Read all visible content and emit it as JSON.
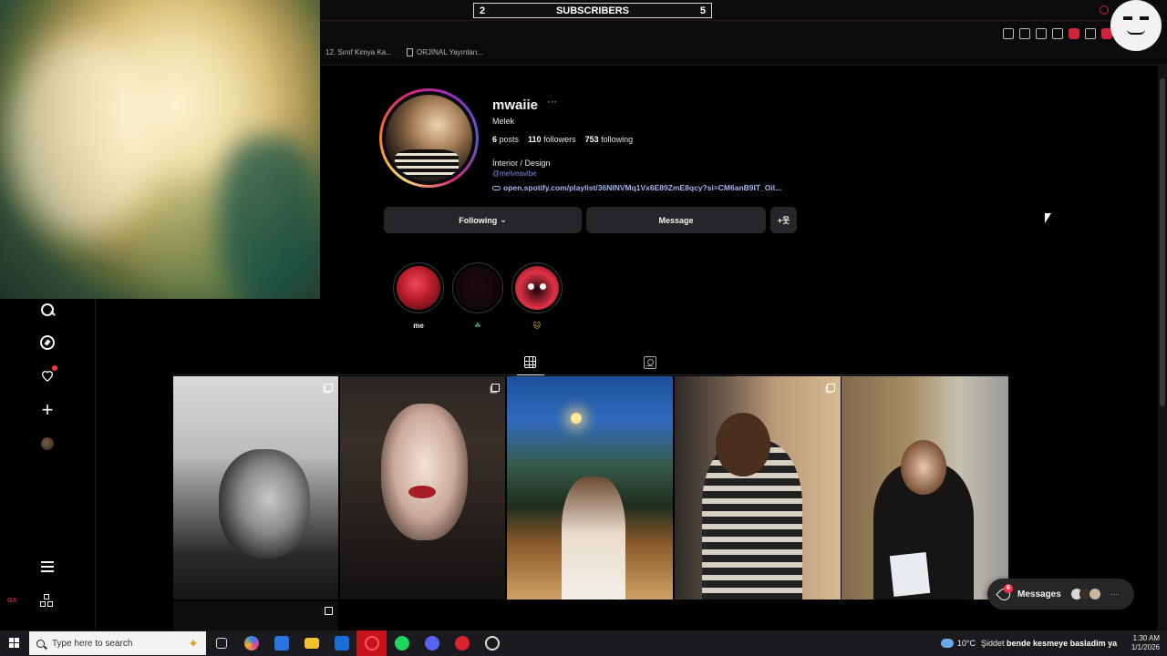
{
  "stream_widget": {
    "left_count": "2",
    "label": "SUBSCRIBERS",
    "right_count": "5"
  },
  "bookmarks": [
    {
      "label": "12. Sınıf Kimya Ka..."
    },
    {
      "label": "ORJİNAL Yayınları..."
    }
  ],
  "profile": {
    "username": "mwaiie",
    "more": "···",
    "full_name": "Melek",
    "stats": {
      "posts_count": "6",
      "posts_label": "posts",
      "followers_count": "110",
      "followers_label": "followers",
      "following_count": "753",
      "following_label": "following"
    },
    "bio": "İnterior / Design",
    "handle": "@melveavibe",
    "link": "open.spotify.com/playlist/36NINVMq1Vx6E89ZmE8qcy?si=CM6anB9IT_Oil...",
    "buttons": {
      "following": "Following",
      "message": "Message",
      "suggest": "+웃"
    }
  },
  "highlights": [
    {
      "label": "me"
    },
    {
      "label": "☘"
    },
    {
      "label": "🐱"
    }
  ],
  "messages": {
    "label": "Messages",
    "badge": "6",
    "more": "···"
  },
  "taskbar": {
    "search_placeholder": "Type here to search",
    "weather": "10°C",
    "ticker_prefix": "Şiddet",
    "ticker_text": "bende kesmeye basladim ya u",
    "time": "1:30 AM",
    "date": "1/1/2026"
  },
  "theme": {
    "accent": "#d0243c",
    "link": "#a4b4f2",
    "button_bg": "#26262a",
    "notification": "#ff3040"
  },
  "icons": [
    "search-icon",
    "explore-icon",
    "heart-icon",
    "create-icon",
    "menu-icon",
    "threads-icon",
    "grid-icon",
    "tagged-icon",
    "link-icon",
    "messages-icon",
    "windows-start-icon",
    "sparkle-icon"
  ]
}
